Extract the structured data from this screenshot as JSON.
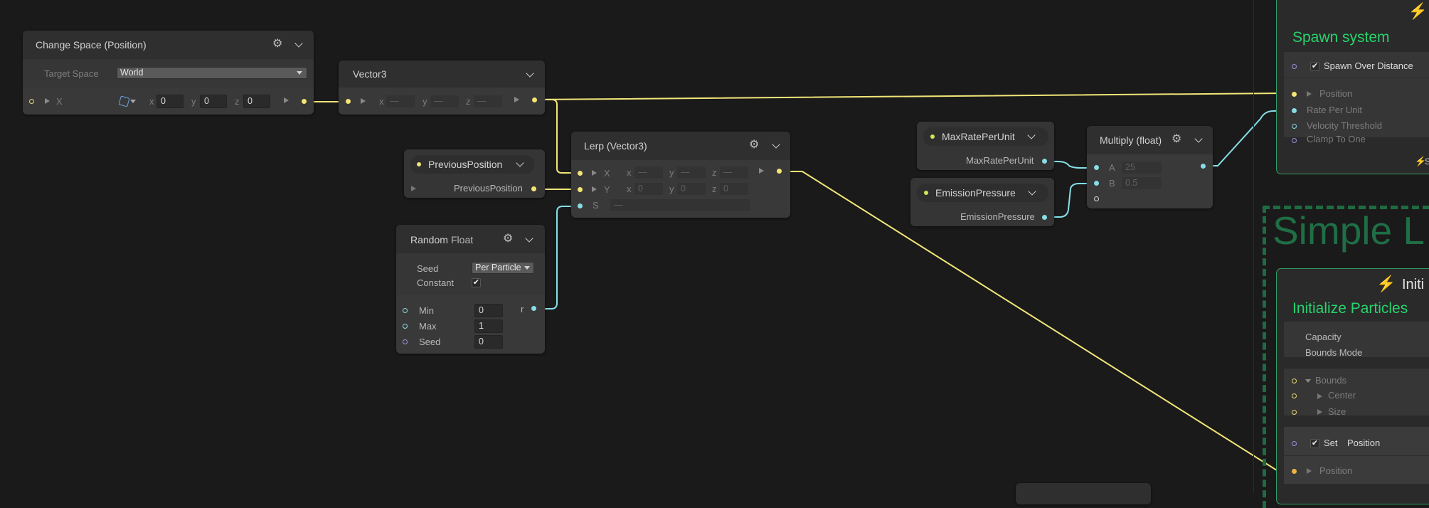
{
  "colors": {
    "wire_vec3": "#f2e679",
    "wire_float": "#86e0e8",
    "context_green": "#2dd670",
    "background": "#1a1a1a"
  },
  "change_space": {
    "title": "Change Space (Position)",
    "target_space_label": "Target Space",
    "target_space_value": "World",
    "port_label": "X",
    "x_label": "x",
    "x_value": "0",
    "y_label": "y",
    "y_value": "0",
    "z_label": "z",
    "z_value": "0",
    "space_icon": "cube-space-icon"
  },
  "vector3": {
    "title": "Vector3",
    "port_label": "X",
    "x_label": "x",
    "y_label": "y",
    "z_label": "z",
    "x_value": "—",
    "y_value": "—",
    "z_value": "—"
  },
  "previous_position": {
    "pill_label": "PreviousPosition",
    "output_label": "PreviousPosition"
  },
  "lerp": {
    "title": "Lerp (Vector3)",
    "x_port": "X",
    "y_port": "Y",
    "s_port": "S",
    "x_x": "—",
    "x_y": "—",
    "x_z": "—",
    "y_x": "0",
    "y_y": "0",
    "y_z": "0",
    "s_value": "—",
    "x_label": "x",
    "y_label": "y",
    "z_label": "z"
  },
  "random": {
    "title": "Random",
    "type": "Float",
    "seed_label": "Seed",
    "seed_mode": "Per Particle",
    "constant_label": "Constant",
    "constant_checked": "✔",
    "min_label": "Min",
    "min_value": "0",
    "max_label": "Max",
    "max_value": "1",
    "seed_port_label": "Seed",
    "seed_value": "0",
    "output_label": "r"
  },
  "max_rate": {
    "pill_label": "MaxRatePerUnit",
    "output_label": "MaxRatePerUnit"
  },
  "emission": {
    "pill_label": "EmissionPressure",
    "output_label": "EmissionPressure"
  },
  "multiply": {
    "title": "Multiply (float)",
    "a_label": "A",
    "a_value": "25",
    "b_label": "B",
    "b_value": "0.5"
  },
  "spawn_context": {
    "title": "Spawn system",
    "block_title": "Spawn Over Distance",
    "block_checked": "✔",
    "ports": [
      "Position",
      "Rate Per Unit",
      "Velocity Threshold",
      "Clamp To One"
    ],
    "footer": "S"
  },
  "simple_label": "Simple L",
  "init_context": {
    "header_title": "Initi",
    "title": "Initialize Particles",
    "capacity_label": "Capacity",
    "bounds_mode_label": "Bounds Mode",
    "bounds_label": "Bounds",
    "center_label": "Center",
    "size_label": "Size",
    "set_label": "Set",
    "set_attribute": "Position",
    "set_checked": "✔",
    "position_label": "Position"
  }
}
